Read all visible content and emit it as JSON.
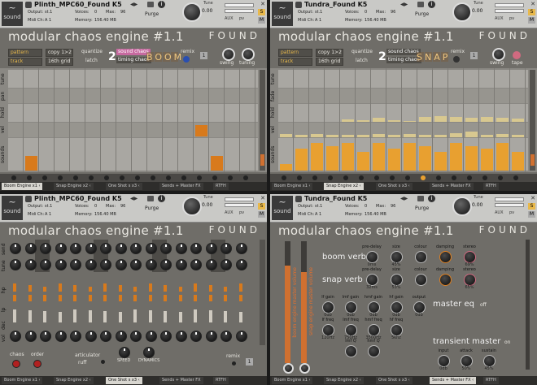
{
  "panels": [
    {
      "instrument": "Plinth_MPC60_Found K5",
      "output": "st.1",
      "voices": "0",
      "max": "96",
      "purge": "Purge",
      "midi_ch": "A 1",
      "memory": "156.40 MB",
      "tune_label": "Tune",
      "tune": "0.00",
      "title": "modular chaos engine #1.1",
      "found": "FOUND",
      "pattern": "pattern",
      "copy": "copy 1>2",
      "quantize": "quantize",
      "track": "track",
      "grid": "16th grid",
      "latch": "latch",
      "bank": "2",
      "sound_chaos": "sound chaos",
      "timing_chaos": "timing chaos",
      "effect_word": "BOOM",
      "remix": "remix",
      "swing": "swing",
      "tuning": "tuning",
      "rows": [
        "tune",
        "pan",
        "hold",
        "vel",
        "sounds"
      ],
      "tabs": [
        "Boom Engine x1 ‹",
        "Snap Engine x2 ‹",
        "One Shot s x3 ‹",
        "Sends + Master FX",
        "RTFH"
      ],
      "active_tab": 0
    },
    {
      "instrument": "Tundra_Found K5",
      "output": "st.1",
      "voices": "0",
      "max": "96",
      "purge": "Purge",
      "midi_ch": "A 1",
      "memory": "156.40 MB",
      "tune_label": "Tune",
      "tune": "0.00",
      "title": "modular chaos engine #1.1",
      "found": "FOUND",
      "pattern": "pattern",
      "copy": "copy 1>2",
      "quantize": "quantize",
      "track": "track",
      "grid": "16th grid",
      "latch": "latch",
      "bank": "2",
      "sound_chaos": "sound chaos",
      "timing_chaos": "timing chaos",
      "effect_word": "SNAP",
      "remix": "remix",
      "swing": "swing",
      "tape": "tape",
      "rows": [
        "tune",
        "fade",
        "hold",
        "vel",
        "sounds"
      ],
      "tabs": [
        "Boom Engine x1 ‹",
        "Snap Engine x2 ‹",
        "One Shot s x3 ‹",
        "Sends + Master FX",
        "RTFH"
      ],
      "active_tab": 1
    },
    {
      "instrument": "Plinth_MPC60_Found K5",
      "output": "st.1",
      "voices": "0",
      "max": "96",
      "purge": "Purge",
      "midi_ch": "A 1",
      "memory": "156.40 MB",
      "tune_label": "Tune",
      "tune": "0.00",
      "title": "modular chaos engine #1.1",
      "found": "FOUND",
      "rows": [
        "send",
        "tune",
        "hp",
        "lp",
        "dec",
        "vol"
      ],
      "chaos": "chaos",
      "order": "order",
      "articulator": "articulator",
      "ruff": "ruff",
      "speed": "SPEED",
      "dynamics": "DYNAMICS",
      "remix": "remix",
      "tabs": [
        "Boom Engine x1 ‹",
        "Snap Engine x2 ‹",
        "One Shot s x3 ‹",
        "Sends + Master FX",
        "RTFH"
      ],
      "active_tab": 2
    },
    {
      "instrument": "Tundra_Found K5",
      "output": "st.1",
      "voices": "0",
      "max": "96",
      "purge": "Purge",
      "midi_ch": "A 1",
      "memory": "156.40 MB",
      "tune_label": "Tune",
      "tune": "0.00",
      "title": "modular chaos engine #1.1",
      "found": "FOUND",
      "boom_verb": "boom verb",
      "snap_verb": "snap verb",
      "master_eq": "master eq",
      "off": "off",
      "transient_master": "transient master",
      "on": "on",
      "boom_engine_master_volume": "boom engine master volume",
      "snap_engine_master_volume": "snap engine master volume",
      "boom_knobs": [
        [
          "pre-delay",
          "0ms"
        ],
        [
          "size",
          "45%"
        ],
        [
          "colour",
          ""
        ],
        [
          "damping",
          ""
        ],
        [
          "stereo",
          "69%"
        ]
      ],
      "snap_knobs": [
        [
          "pre-delay",
          "32ms"
        ],
        [
          "size",
          "53%"
        ],
        [
          "colour",
          ""
        ],
        [
          "damping",
          ""
        ],
        [
          "stereo",
          "65%"
        ]
      ],
      "eq_row1": [
        [
          "lf gain",
          "0db"
        ],
        [
          "lmf gain",
          "0db"
        ],
        [
          "hmf gain",
          "0db"
        ],
        [
          "hf gain",
          "0db"
        ],
        [
          "output",
          "0db"
        ]
      ],
      "eq_row2": [
        [
          "lf freq",
          "120Hz"
        ],
        [
          "lmf freq",
          "750Hz"
        ],
        [
          "hmf freq",
          "3500Hz"
        ],
        [
          "hf freq",
          "5khz"
        ]
      ],
      "eq_row3": [
        [
          "lmf Q",
          ""
        ],
        [
          "hmf Q",
          ""
        ]
      ],
      "transient_knobs": [
        [
          "input",
          "0db"
        ],
        [
          "attack",
          "50%"
        ],
        [
          "sustain",
          "45%"
        ]
      ],
      "tabs": [
        "Boom Engine x1 ‹",
        "Snap Engine x2 ‹",
        "One Shot s x3 ‹",
        "Sends + Master FX ‹",
        "RTFH"
      ],
      "active_tab": 3
    }
  ],
  "labels": {
    "output": "Output:",
    "voices": "Voices:",
    "max": "Max:",
    "midi": "Midi Ch:",
    "memory": "Memory:",
    "aux": "AUX",
    "pv": "pv",
    "sound": "sound"
  },
  "sequencer": {
    "boom_vel_hi": [
      0,
      0,
      0,
      0,
      0,
      0,
      0,
      0,
      0,
      0,
      0,
      0,
      1,
      0,
      0,
      0
    ],
    "boom_sounds": [
      0,
      1,
      0,
      0,
      0,
      0,
      0,
      0,
      0,
      0,
      0,
      0,
      0,
      1,
      0,
      0,
      0
    ],
    "snap_vel": [
      0.3,
      0.2,
      0.3,
      0.25,
      0.2,
      0.25,
      0.3,
      0.2,
      0.3,
      0.25,
      0.2,
      0.35,
      0.5,
      0.25,
      0.3,
      0.2
    ],
    "snap_hold": [
      0,
      0,
      0,
      0,
      0.3,
      0.2,
      0.5,
      0.2,
      0.1,
      0.6,
      0.7,
      0.6,
      0.5,
      0.6,
      0.5,
      0.4
    ],
    "snap_sounds": [
      0.2,
      0.7,
      0.9,
      0.8,
      0.9,
      0.6,
      0.9,
      0.7,
      0.9,
      0.8,
      0.6,
      0.9,
      0.8,
      0.7,
      0.9,
      0.6
    ]
  },
  "colors": {
    "accent": "#e8a030",
    "sounds": "#d87a1c",
    "panel": "#6f6d68",
    "seq": "#a9a7a2"
  }
}
